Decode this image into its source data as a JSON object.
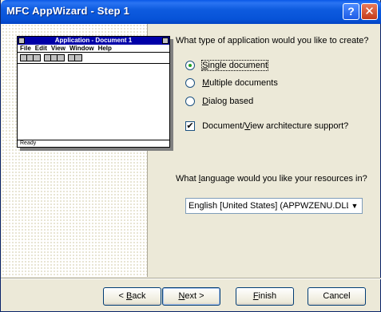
{
  "window": {
    "title": "MFC AppWizard - Step 1",
    "help_symbol": "?",
    "close_symbol": "✕"
  },
  "preview": {
    "title": "Application - Document 1",
    "menu": [
      "File",
      "Edit",
      "View",
      "Window",
      "Help"
    ],
    "status": "Ready"
  },
  "app_type": {
    "question": "What type of application would you like to create?",
    "options": [
      {
        "pre": "",
        "key": "S",
        "post": "ingle document",
        "selected": true
      },
      {
        "pre": "",
        "key": "M",
        "post": "ultiple documents",
        "selected": false
      },
      {
        "pre": "",
        "key": "D",
        "post": "ialog based",
        "selected": false
      }
    ],
    "docview": {
      "pre": "Document/",
      "key": "V",
      "post": "iew architecture support?",
      "checked": true,
      "check_mark": "✔"
    }
  },
  "language": {
    "q_pre": "What ",
    "q_key": "l",
    "q_post": "anguage would you like your resources in?",
    "selected": "English [United States] (APPWZENU.DLL",
    "arrow": "▼"
  },
  "buttons": {
    "back": {
      "pre": "< ",
      "key": "B",
      "post": "ack"
    },
    "next": {
      "key": "N",
      "post": "ext >"
    },
    "finish": {
      "key": "F",
      "post": "inish"
    },
    "cancel": "Cancel"
  }
}
